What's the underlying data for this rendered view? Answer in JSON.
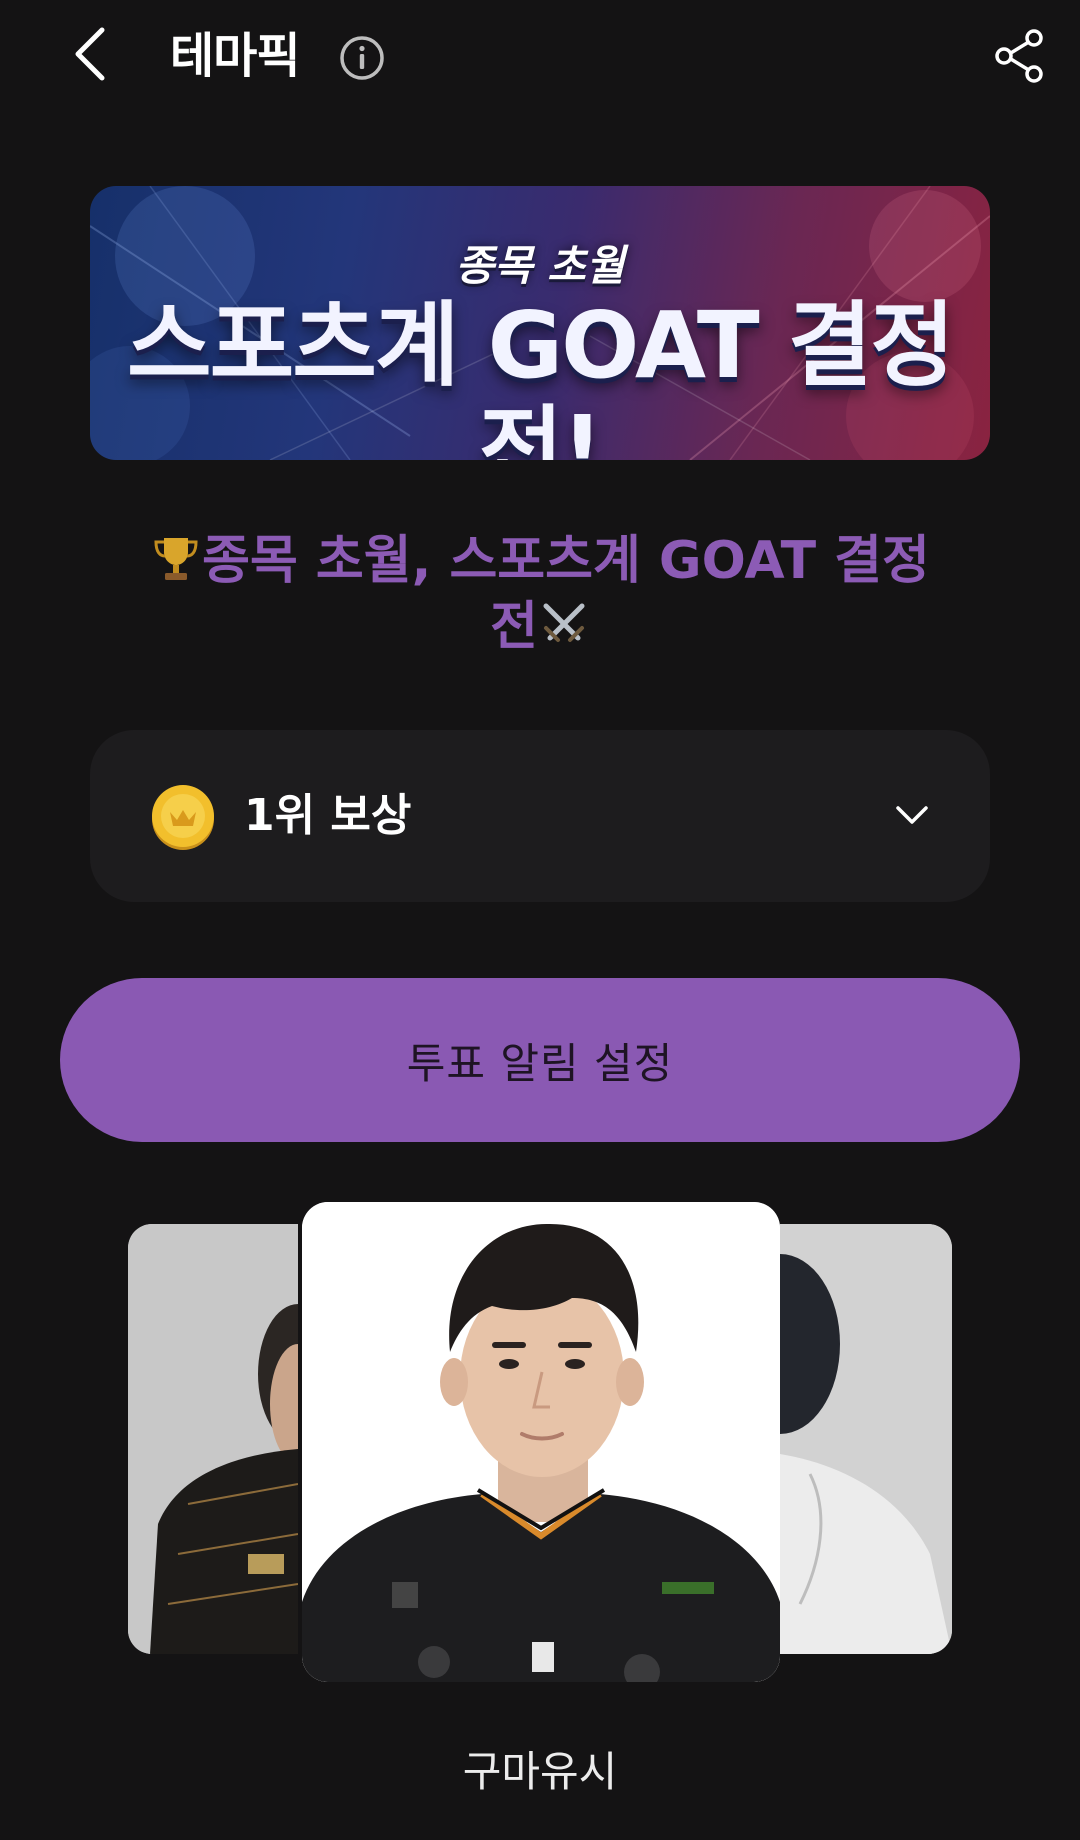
{
  "header": {
    "title": "테마픽",
    "back_icon": "chevron-left-icon",
    "info_icon": "info-circle-icon",
    "share_icon": "share-icon"
  },
  "banner": {
    "subtitle": "종목 초월",
    "title": "스포츠계 GOAT 결정전!"
  },
  "headline": {
    "prefix_icon": "trophy-emoji",
    "text": "종목 초월, 스포츠계 GOAT 결정전",
    "suffix_icon": "crossed-swords-emoji"
  },
  "reward": {
    "icon": "coin-icon",
    "label": "1위 보상",
    "expand_icon": "chevron-down-icon"
  },
  "vote_alert_button": {
    "label": "투표 알림 설정"
  },
  "carousel": {
    "current_candidate": "구마유시"
  },
  "colors": {
    "background": "#141314",
    "accent_purple": "#8a59b3",
    "headline_purple": "#8c5bb5",
    "panel": "#1d1c1e"
  }
}
